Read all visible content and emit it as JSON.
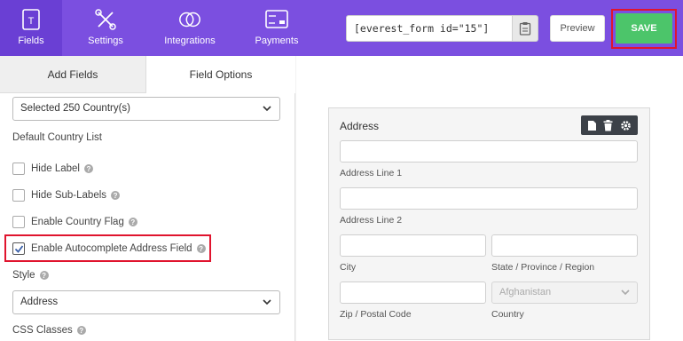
{
  "topbar": {
    "tabs": [
      {
        "label": "Fields",
        "icon": "fields-icon"
      },
      {
        "label": "Settings",
        "icon": "settings-icon"
      },
      {
        "label": "Integrations",
        "icon": "integrations-icon"
      },
      {
        "label": "Payments",
        "icon": "payments-icon"
      }
    ],
    "shortcode": "[everest_form id=\"15\"]",
    "preview_label": "Preview",
    "save_label": "SAVE",
    "colors": {
      "bar": "#7b4fe0",
      "save": "#4cc56a",
      "highlight": "#e0142e"
    }
  },
  "left_panel": {
    "tabs": {
      "add_fields": "Add Fields",
      "field_options": "Field Options"
    },
    "country_select": "Selected 250 Country(s)",
    "default_country_label": "Default Country List",
    "options": [
      {
        "label": "Hide Label",
        "checked": false
      },
      {
        "label": "Hide Sub-Labels",
        "checked": false
      },
      {
        "label": "Enable Country Flag",
        "checked": false
      },
      {
        "label": "Enable Autocomplete Address Field",
        "checked": true
      }
    ],
    "style_label": "Style",
    "style_select": "Address",
    "css_classes_label": "CSS Classes"
  },
  "form": {
    "title": "Address",
    "fields": {
      "address1": "Address Line 1",
      "address2": "Address Line 2",
      "city": "City",
      "state": "State / Province / Region",
      "zip": "Zip / Postal Code",
      "country": "Country",
      "country_value": "Afghanistan"
    }
  }
}
